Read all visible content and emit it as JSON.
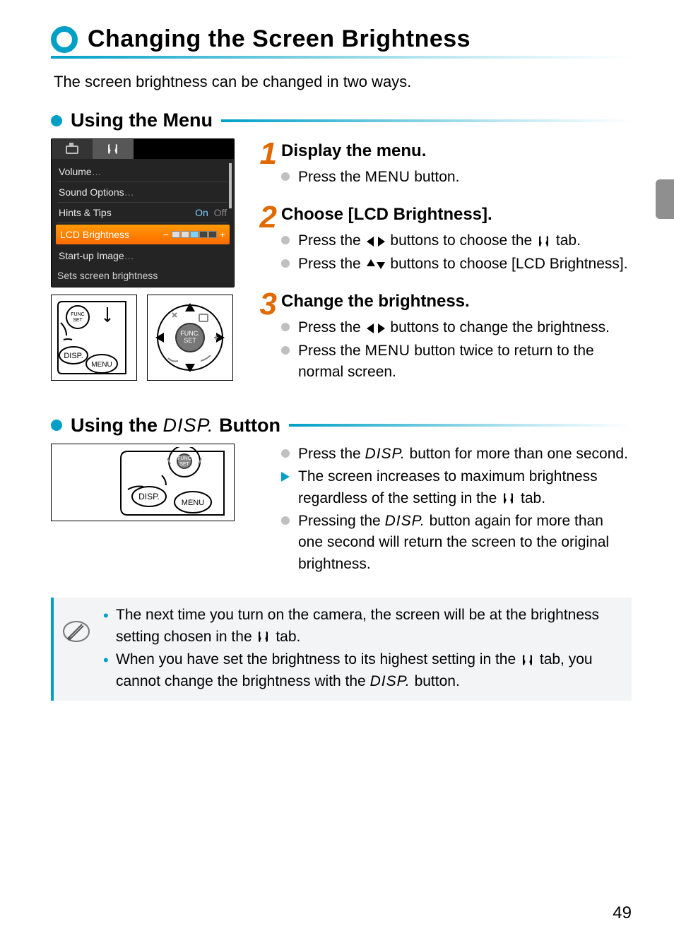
{
  "heading": "Changing the Screen Brightness",
  "intro": "The screen brightness can be changed in two ways.",
  "section1": {
    "title": "Using the Menu"
  },
  "menu": {
    "items": {
      "volume": "Volume",
      "sound": "Sound Options",
      "hints": "Hints & Tips",
      "on": "On",
      "off": "Off",
      "lcd": "LCD Brightness",
      "startup": "Start-up Image"
    },
    "hint": "Sets screen brightness"
  },
  "steps": {
    "s1": {
      "num": "1",
      "title": "Display the menu.",
      "b1a": "Press the ",
      "b1b": " button."
    },
    "s2": {
      "num": "2",
      "title": "Choose [LCD Brightness].",
      "b1a": "Press the ",
      "b1b": " buttons to choose the ",
      "b1c": " tab.",
      "b2a": "Press the ",
      "b2b": " buttons to choose [LCD Brightness]."
    },
    "s3": {
      "num": "3",
      "title": "Change the brightness.",
      "b1a": "Press the ",
      "b1b": " buttons to change the brightness.",
      "b2a": "Press the ",
      "b2b": " button twice to return to the normal screen."
    }
  },
  "section2": {
    "prefix": "Using the ",
    "suffix": " Button"
  },
  "disp": {
    "b1a": "Press the ",
    "b1b": " button for more than one second.",
    "b2a": "The screen increases to maximum brightness regardless of the setting in the ",
    "b2b": " tab.",
    "b3a": "Pressing the ",
    "b3b": " button again for more than one second will return the screen to the original brightness."
  },
  "note": {
    "n1a": "The next time you turn on the camera, the screen will be at the brightness setting chosen in the ",
    "n1b": " tab.",
    "n2a": "When you have set the brightness to its highest setting in the ",
    "n2b": " tab, you cannot change the brightness with the ",
    "n2c": " button."
  },
  "glyph": {
    "menu": "MENU",
    "disp": "DISP."
  },
  "page_number": "49"
}
